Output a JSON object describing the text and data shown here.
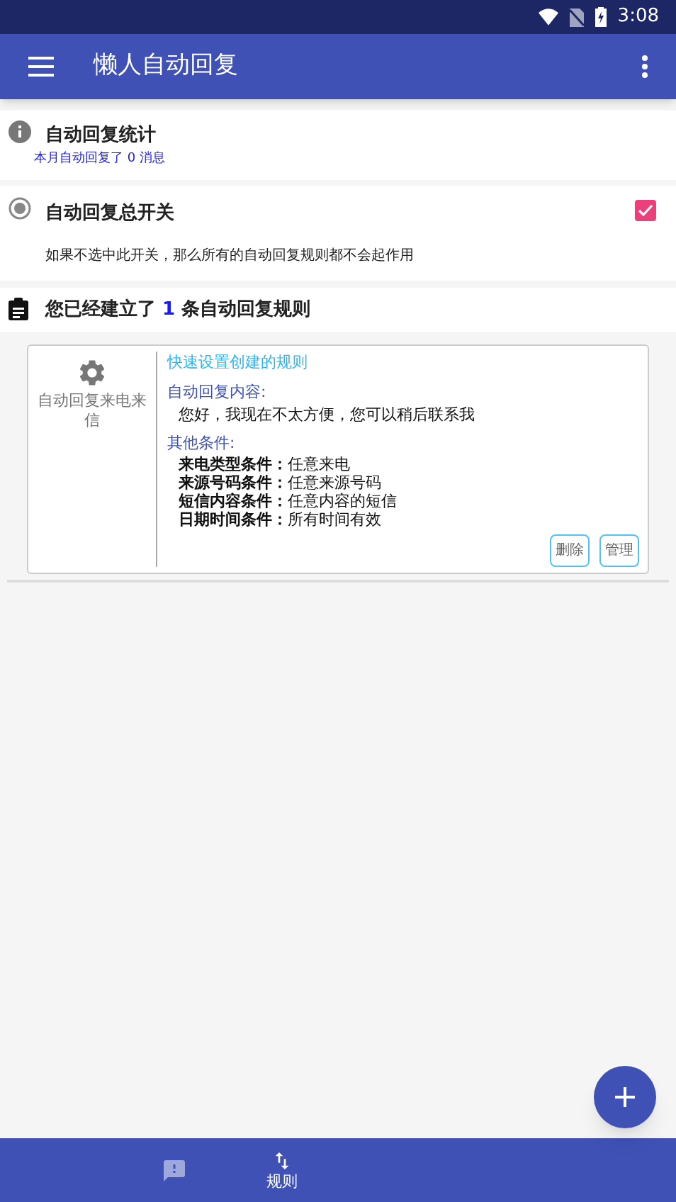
{
  "status_bar": {
    "time": "3:08"
  },
  "app_bar": {
    "title": "懒人自动回复"
  },
  "stats": {
    "title": "自动回复统计",
    "summary": "本月自动回复了 0 消息"
  },
  "master_switch": {
    "title": "自动回复总开关",
    "checked": true,
    "description": "如果不选中此开关，那么所有的自动回复规则都不会起作用"
  },
  "rules_header": {
    "prefix": "您已经建立了",
    "count": "1",
    "suffix": "条自动回复规则"
  },
  "rules": [
    {
      "name": "自动回复来电来信",
      "title": "快速设置创建的规则",
      "content_label": "自动回复内容:",
      "content": "您好，我现在不太方便，您可以稍后联系我",
      "conditions_label": "其他条件:",
      "conditions": [
        {
          "label": "来电类型条件：",
          "value": "任意来电"
        },
        {
          "label": "来源号码条件：",
          "value": "任意来源号码"
        },
        {
          "label": "短信内容条件：",
          "value": "任意内容的短信"
        },
        {
          "label": "日期时间条件：",
          "value": "所有时间有效"
        }
      ],
      "buttons": [
        "删除",
        "管理"
      ]
    }
  ],
  "bottom_nav": [
    {
      "kind": "feedback",
      "selected": false
    },
    {
      "kind": "rules",
      "label": "规则",
      "selected": true
    }
  ]
}
